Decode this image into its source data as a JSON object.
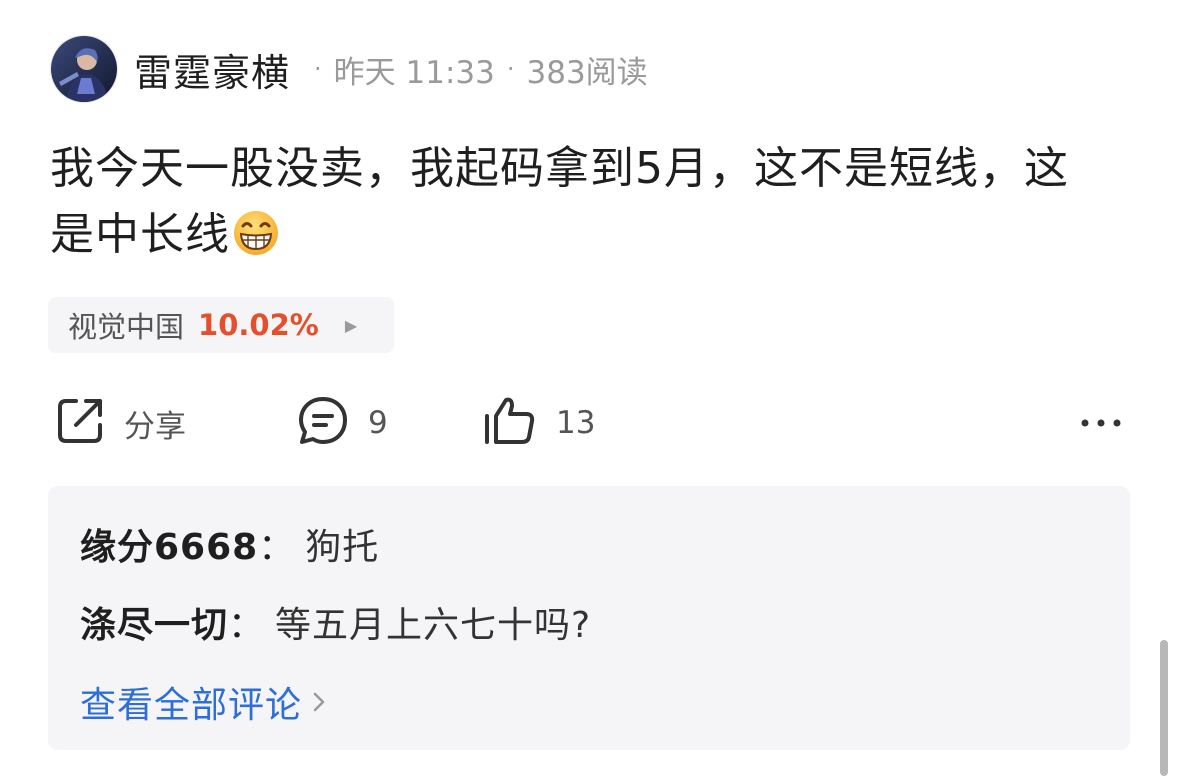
{
  "post": {
    "author": "雷霆豪横",
    "time": "昨天 11:33",
    "reads": "383阅读",
    "text": "我今天一股没卖，我起码拿到5月，这不是短线，这是中长线",
    "emoji": "grinning-face-emoji"
  },
  "stock": {
    "name": "视觉中国",
    "change": "10.02%",
    "change_color": "#e4502b"
  },
  "actions": {
    "share_label": "分享",
    "comment_count": "9",
    "like_count": "13"
  },
  "comments": [
    {
      "user": "缘分6668",
      "text": "狗托"
    },
    {
      "user": "涤尽一切",
      "text": "等五月上六七十吗?"
    }
  ],
  "view_all_label": "查看全部评论",
  "colors": {
    "accent_blue": "#2d6fd6",
    "gray_text": "#9a9a9a",
    "panel_bg": "#f5f5f7"
  }
}
